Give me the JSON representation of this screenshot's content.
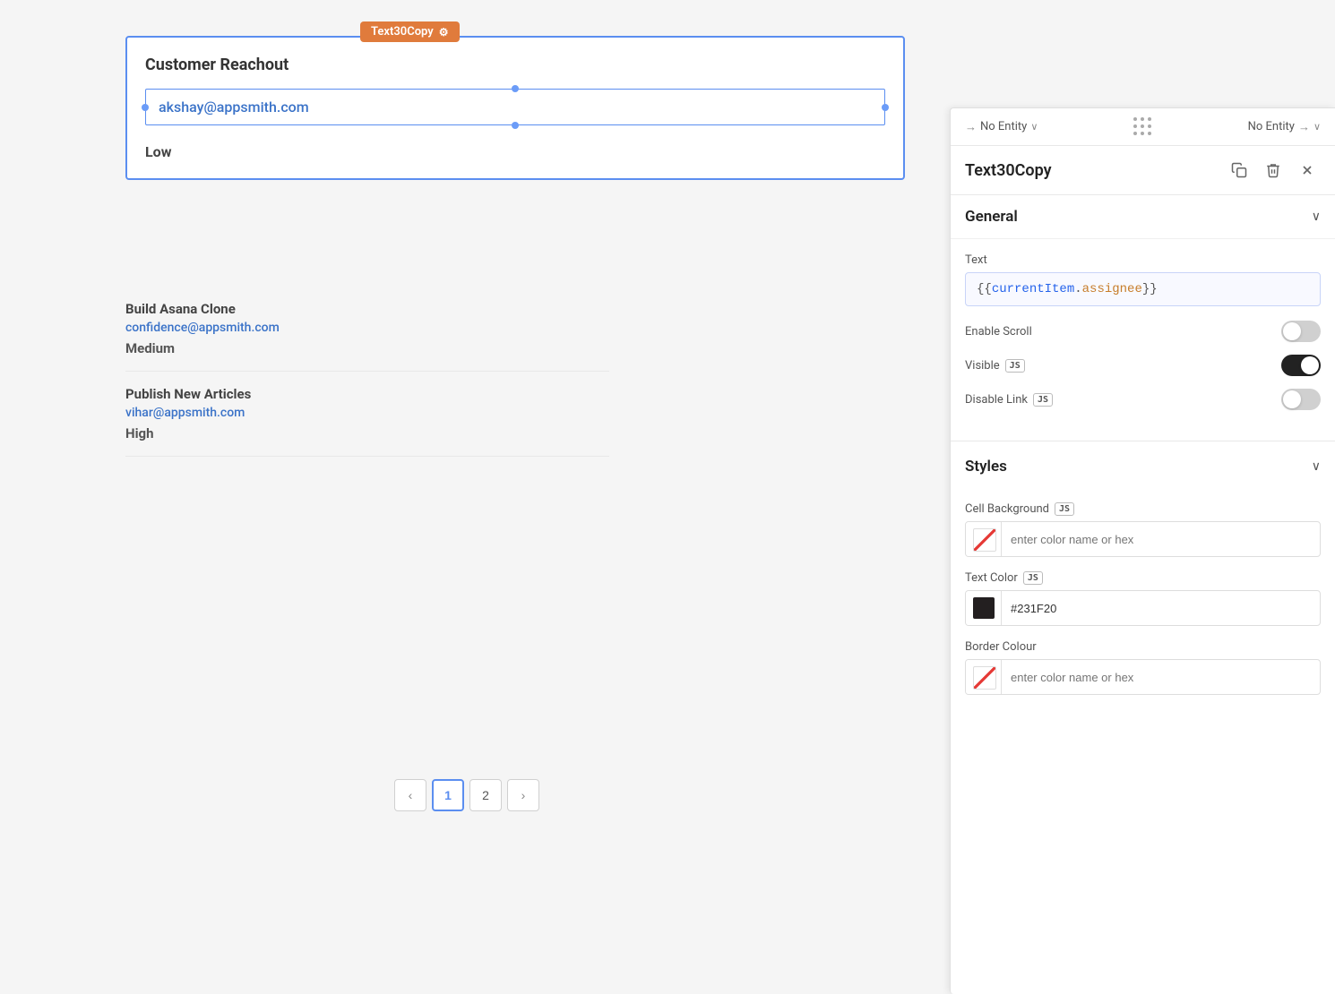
{
  "canvas": {
    "background": "#f5f5f5"
  },
  "widget": {
    "title": "Customer Reachout",
    "badge_label": "Text30Copy",
    "badge_gear": "⚙",
    "email": "akshay@appsmith.com",
    "priority": "Low"
  },
  "table_rows": [
    {
      "title": "Build Asana Clone",
      "email": "confidence@appsmith.com",
      "priority": "Medium"
    },
    {
      "title": "Publish New Articles",
      "email": "vihar@appsmith.com",
      "priority": "High"
    }
  ],
  "pagination": {
    "prev": "‹",
    "next": "›",
    "pages": [
      "1",
      "2"
    ],
    "active_page": "1"
  },
  "right_panel": {
    "entity_left": {
      "arrow": "→",
      "label": "No Entity",
      "chevron": "∨"
    },
    "entity_right": {
      "label": "No Entity",
      "arrow": "→",
      "chevron": "∨"
    },
    "widget_name": "Text30Copy",
    "copy_icon": "⧉",
    "delete_icon": "🗑",
    "close_icon": "✕",
    "general_section": {
      "title": "General",
      "chevron": "∨",
      "text_label": "Text",
      "text_value": "{{currentItem.assignee}}",
      "enable_scroll_label": "Enable Scroll",
      "enable_scroll_state": "off",
      "visible_label": "Visible",
      "visible_js": "JS",
      "visible_state": "on",
      "disable_link_label": "Disable Link",
      "disable_link_js": "JS",
      "disable_link_state": "off"
    },
    "styles_section": {
      "title": "Styles",
      "chevron": "∨",
      "cell_bg_label": "Cell Background",
      "cell_bg_js": "JS",
      "cell_bg_placeholder": "enter color name or hex",
      "text_color_label": "Text Color",
      "text_color_js": "JS",
      "text_color_value": "#231F20",
      "border_color_label": "Border Colour",
      "border_color_placeholder": "enter color name or hex"
    }
  }
}
